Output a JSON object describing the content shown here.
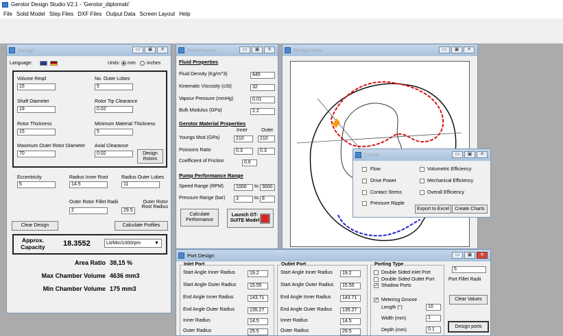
{
  "app": {
    "title": "Gerotor Design Studio V2.1 - 'Gerotor_diplomski'",
    "menu": [
      "File",
      "Solid Model",
      "Step Files",
      "DXF Files",
      "Output Data",
      "Screen Layout",
      "Help"
    ]
  },
  "design": {
    "title": "Design",
    "language_label": "Language:",
    "units_label": "Units:",
    "unit_mm": "mm",
    "unit_inches": "inches",
    "volume_label": "Volume Reqd",
    "volume": "15",
    "lobes_label": "No. Outer Lobes",
    "lobes": "5",
    "shaft_label": "Shaft Diameter",
    "shaft": "19",
    "tip_label": "Rotor Tip Clearance",
    "tip": "0.02",
    "thick_label": "Rotor Thickness",
    "thick": "15",
    "minmat_label": "Minimum Material Thickness",
    "minmat": "5",
    "maxdia_label": "Maximum Outer Rotor Diameter",
    "maxdia": "70",
    "axial_label": "Axial Clearance",
    "axial": "0.02",
    "design_rotors": "Design Rotors",
    "ecc_label": "Eccentricity",
    "ecc": "5",
    "rinner_label": "Radius Inner Root",
    "rinner": "14.5",
    "rlobes_label": "Radius Outer Lobes",
    "rlobes": "11",
    "fillet_label": "Outer Rotor Fillet Radii",
    "fillet": "2",
    "root_label": "Outer Rotor Root Radius",
    "root": "29.5",
    "clear_design": "Clear Design",
    "calc_profiles": "Calculate Profiles",
    "approx_label": "Approx. Capacity",
    "capacity": "18.3552",
    "capacity_unit": "Lit/Min/1000rpm",
    "area_label": "Area Ratio",
    "area": "38,15 %",
    "maxch_label": "Max Chamber Volume",
    "maxch": "4636 mm3",
    "minch_label": "Min Chamber Volume",
    "minch": "175 mm3"
  },
  "perf": {
    "title": "Performance",
    "fluid_hdr": "Fluid Properties",
    "density_label": "Fluid Density (Kg/m^3)",
    "density": "845",
    "visc_label": "Kinematic Viscosity (cSt)",
    "visc": "32",
    "vapour_label": "Vapour Pressure (mmHg)",
    "vapour": "0.01",
    "bulk_label": "Bulk Modulus (GPa)",
    "bulk": "2.2",
    "mat_hdr": "Gerotor Material Properties",
    "inner": "Inner",
    "outer": "Outer",
    "youngs_label": "Youngs Mod (GPa)",
    "youngs_in": "210",
    "youngs_out": "210",
    "poisson_label": "Poissons Ratio",
    "poisson_in": "0.3",
    "poisson_out": "0.3",
    "friction_label": "Coefficient of Friction",
    "friction": "0.6",
    "range_hdr": "Pump Performance Range",
    "speed_label": "Speed Range (RPM)",
    "speed_from": "1000",
    "to": "to",
    "speed_to": "3000",
    "press_label": "Pressure Range (bar)",
    "press_from": "3",
    "press_to": "8",
    "calc_perf": "Calculate Performance",
    "launch": "Launch GT-SUITE Model"
  },
  "view": {
    "title": "Design View"
  },
  "charts": {
    "title": "Charts",
    "flow": "Flow",
    "drive": "Drive Power",
    "contact": "Contact Stress",
    "ripple": "Pressure Ripple",
    "vol_eff": "Volumetric Efficiency",
    "mech_eff": "Mechanical Efficiency",
    "overall": "Overall Efficiency",
    "export": "Export to Excel",
    "create": "Create Charts"
  },
  "port": {
    "title": "Port Design",
    "inlet_hdr": "Inlet Port",
    "outlet_hdr": "Outlet Port",
    "porting_hdr": "Porting Type",
    "rows": [
      {
        "label": "Start Angle Inner Radius",
        "inlet": "19.2",
        "outlet": "19.2"
      },
      {
        "label": "Start Angle Outer Radius",
        "inlet": "15.55",
        "outlet": "15.55"
      },
      {
        "label": "End Angle Inner Radius",
        "inlet": "143.71",
        "outlet": "143.71"
      },
      {
        "label": "End Angle Outer Radius",
        "inlet": "135.27",
        "outlet": "135.27"
      },
      {
        "label": "Inner Radius",
        "inlet": "14.5",
        "outlet": "14.5"
      },
      {
        "label": "Outer Radius",
        "inlet": "29.5",
        "outlet": "29.5"
      }
    ],
    "dsi": "Double Sided Inlet Port",
    "dso": "Double Sided Outlet Port",
    "shadow": "Shadow Ports",
    "metering": "Metering Groove",
    "length_label": "Length (°)",
    "length": "10",
    "width_label": "Width (mm)",
    "width": "1",
    "depth_label": "Depth (mm)",
    "depth": "0.1",
    "fillet": "5",
    "fillet_label": "Port Fillet Radii",
    "clear": "Clear Values",
    "design_ports": "Design ports"
  }
}
